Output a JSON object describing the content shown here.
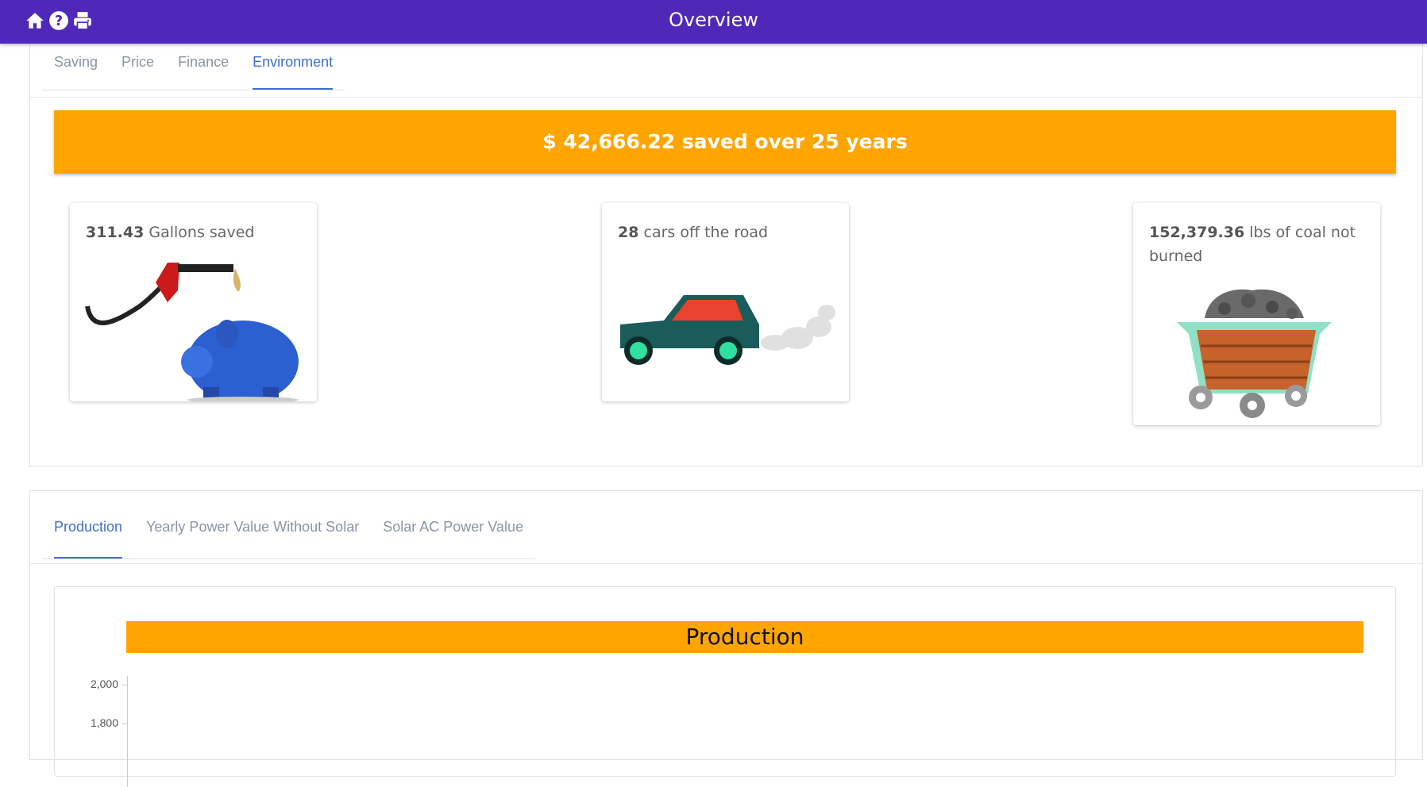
{
  "header": {
    "title": "Overview",
    "icons": [
      "home-icon",
      "help-icon",
      "print-icon"
    ]
  },
  "tabs": [
    {
      "label": "Saving",
      "active": false
    },
    {
      "label": "Price",
      "active": false
    },
    {
      "label": "Finance",
      "active": false
    },
    {
      "label": "Environment",
      "active": true
    }
  ],
  "banner": {
    "text": "$ 42,666.22 saved over 25 years"
  },
  "cards": [
    {
      "value": "311.43",
      "text": "Gallons saved",
      "icon": "piggy-bank-fuel-icon"
    },
    {
      "value": "28",
      "text": "cars off the road",
      "icon": "car-exhaust-icon"
    },
    {
      "value": "152,379.36",
      "text": "lbs of coal not burned",
      "icon": "coal-cart-icon"
    }
  ],
  "chart_tabs": [
    {
      "label": "Production",
      "active": true
    },
    {
      "label": "Yearly Power Value Without Solar",
      "active": false
    },
    {
      "label": "Solar AC Power Value",
      "active": false
    }
  ],
  "chart_data": {
    "type": "bar",
    "title": "Production",
    "yticks": [
      "2,000",
      "1,800"
    ]
  },
  "colors": {
    "header": "#5028b9",
    "accent": "#ffa500",
    "active_tab": "#3f6fcf"
  }
}
